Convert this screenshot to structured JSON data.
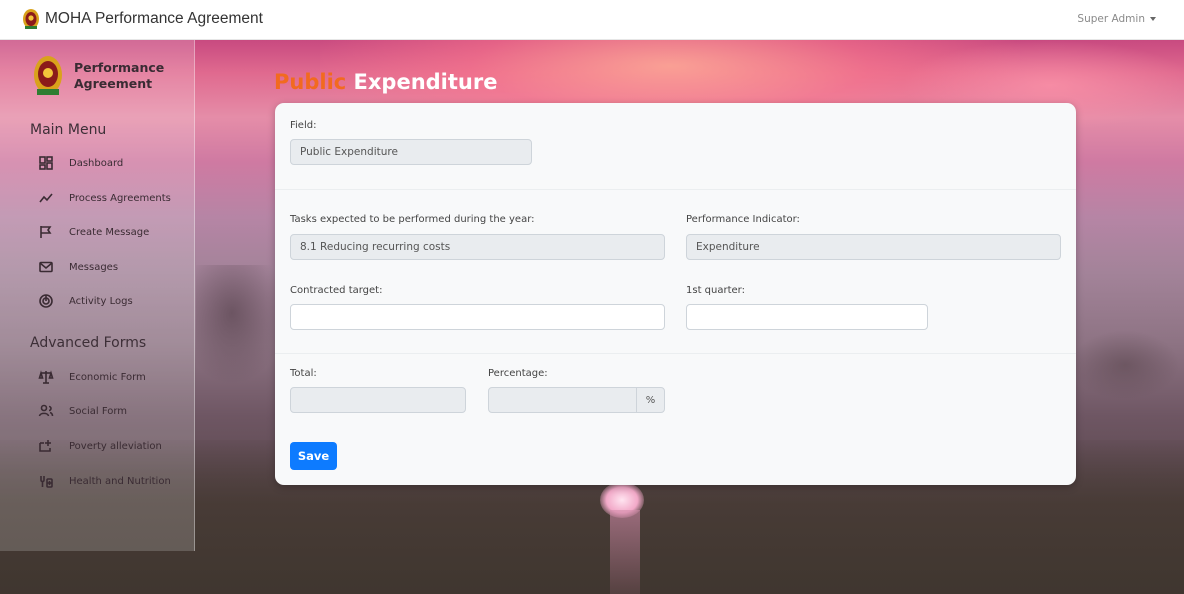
{
  "navbar": {
    "title": "MOHA Performance Agreement",
    "user": "Super Admin"
  },
  "sidebar": {
    "brand": "Performance Agreement",
    "main_menu_title": "Main Menu",
    "main_items": [
      {
        "label": "Dashboard",
        "icon": "dashboard-icon"
      },
      {
        "label": "Process Agreements",
        "icon": "trend-line-icon"
      },
      {
        "label": "Create Message",
        "icon": "flag-icon"
      },
      {
        "label": "Messages",
        "icon": "envelope-icon"
      },
      {
        "label": "Activity Logs",
        "icon": "spiral-icon"
      }
    ],
    "advanced_title": "Advanced Forms",
    "advanced_items": [
      {
        "label": "Economic Form",
        "icon": "scale-icon"
      },
      {
        "label": "Social Form",
        "icon": "users-icon"
      },
      {
        "label": "Poverty alleviation",
        "icon": "plus-box-icon"
      },
      {
        "label": "Health and Nutrition",
        "icon": "health-icon"
      }
    ]
  },
  "page": {
    "title_part1": "Public",
    "title_part2": "Expenditure"
  },
  "form": {
    "field_label": "Field:",
    "field_value": "Public Expenditure",
    "tasks_label": "Tasks expected to be performed during the year:",
    "tasks_value": "8.1 Reducing recurring costs",
    "indicator_label": "Performance Indicator:",
    "indicator_value": "Expenditure",
    "target_label": "Contracted target:",
    "target_value": "",
    "quarter_label": "1st quarter:",
    "quarter_value": "",
    "total_label": "Total:",
    "total_value": "",
    "percentage_label": "Percentage:",
    "percentage_value": "",
    "percentage_unit": "%",
    "save_label": "Save"
  },
  "colors": {
    "accent_orange": "#f26a1f",
    "primary_button": "#0d7bff"
  }
}
